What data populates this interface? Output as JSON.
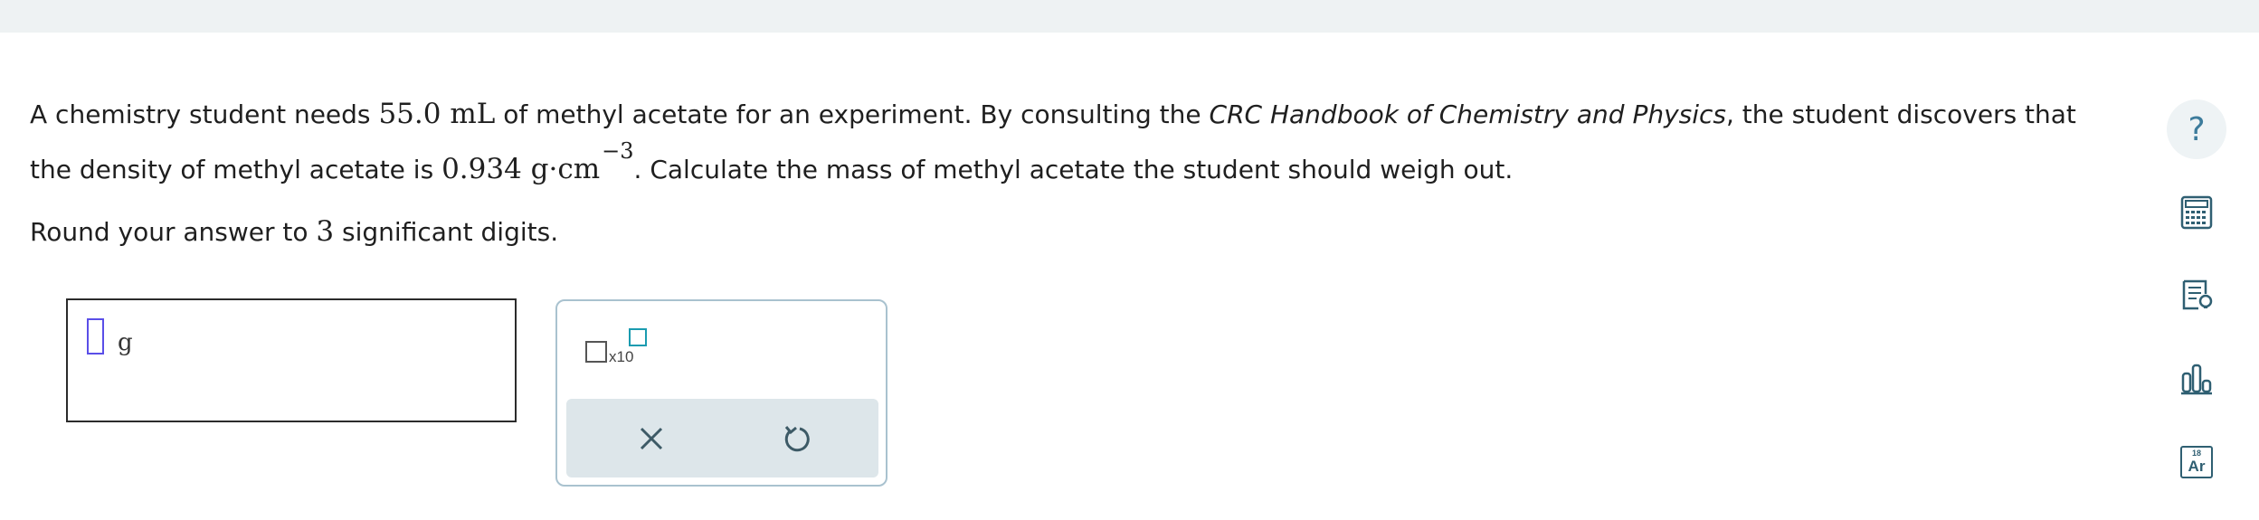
{
  "question": {
    "part1": "A chemistry student needs ",
    "volume": "55.0 mL",
    "part2": " of methyl acetate for an experiment. By consulting the ",
    "source_italic": "CRC Handbook of Chemistry and Physics",
    "part3": ", the student discovers that",
    "part4": "the density of methyl acetate is ",
    "density": "0.934 g·cm",
    "density_exp": "−3",
    "part5": ". Calculate the mass of methyl acetate the student should weigh out."
  },
  "instruction": {
    "prefix": "Round your answer to ",
    "digits": "3",
    "suffix": " significant digits."
  },
  "answer": {
    "unit": "g",
    "value": ""
  },
  "toolbox": {
    "x10_label": "x10",
    "clear_icon": "close-icon",
    "undo_icon": "undo-icon"
  },
  "sidebar": {
    "help_label": "?",
    "tools": [
      "help-icon",
      "calculator-icon",
      "explanation-icon",
      "data-chart-icon",
      "periodic-table-icon"
    ],
    "periodic_tile": {
      "number": "18",
      "symbol": "Ar"
    }
  },
  "colors": {
    "accent": "#3d7c9c",
    "cursor": "#5a4ee8",
    "exponent_box": "#1a9bb0",
    "topbar": "#eef2f3",
    "panel_border": "#a9c2cf",
    "action_bar": "#dde6ea"
  }
}
